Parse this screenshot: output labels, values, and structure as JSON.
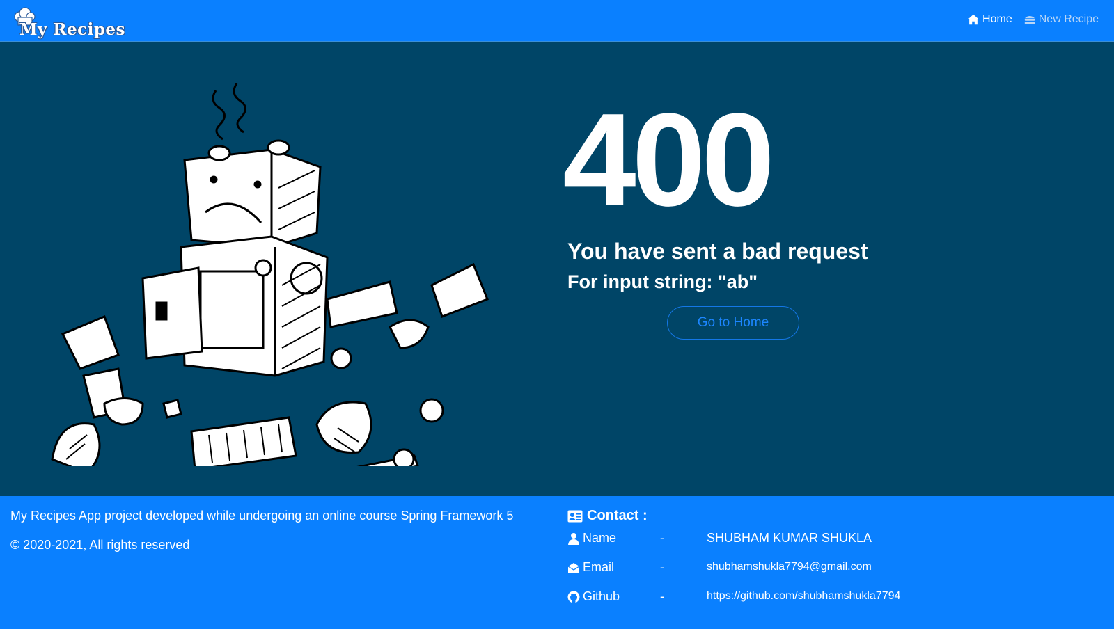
{
  "navbar": {
    "brand": "My Recipes",
    "links": [
      {
        "label": "Home",
        "icon": "home-icon"
      },
      {
        "label": "New Recipe",
        "icon": "burger-icon"
      }
    ]
  },
  "error": {
    "code": "400",
    "title": "You have sent a bad request",
    "detail": "For input string: \"ab\"",
    "button": "Go to Home"
  },
  "footer": {
    "description": "My Recipes App project developed while undergoing an online course Spring Framework 5",
    "copyright": "© 2020-2021, All rights reserved",
    "contact_title": "Contact :",
    "contacts": [
      {
        "label": "Name",
        "icon": "user-icon",
        "separator": "-",
        "value": "SHUBHAM KUMAR SHUKLA"
      },
      {
        "label": "Email",
        "icon": "envelope-icon",
        "separator": "-",
        "value": "shubhamshukla7794@gmail.com"
      },
      {
        "label": "Github",
        "icon": "github-icon",
        "separator": "-",
        "value": "https://github.com/shubhamshukla7794"
      }
    ]
  },
  "colors": {
    "navbar": "#0a80ff",
    "main_bg": "#004567",
    "footer": "#0a80ff",
    "button_border": "#1477e6"
  }
}
